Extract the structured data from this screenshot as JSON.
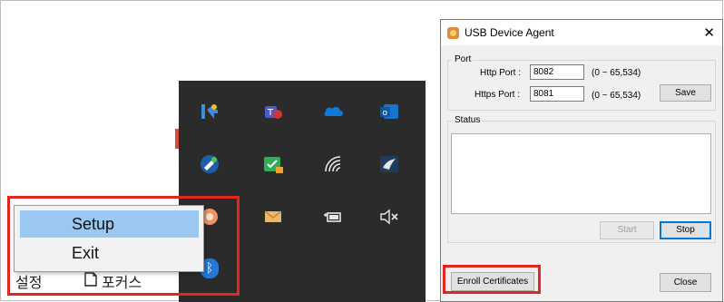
{
  "context_menu": {
    "items": [
      {
        "label": "Setup",
        "highlighted": true
      },
      {
        "label": "Exit",
        "highlighted": false
      }
    ]
  },
  "taskbar": {
    "settings_label": "설정",
    "focus_label": "포커스"
  },
  "tray": {
    "icons": [
      "app-key-icon",
      "teams-icon",
      "onedrive-icon",
      "outlook-icon",
      "satellite-icon",
      "check-lock-icon",
      "wifi-icon",
      "screen-icon",
      "app-orange-icon",
      "mail-icon",
      "battery-icon",
      "volume-mute-icon",
      "bluetooth-icon"
    ]
  },
  "dialog": {
    "title": "USB Device Agent",
    "close_glyph": "✕",
    "port_group_label": "Port",
    "http_label": "Http Port :",
    "http_value": "8082",
    "http_range": "(0 ~ 65,534)",
    "https_label": "Https Port :",
    "https_value": "8081",
    "https_range": "(0 ~ 65,534)",
    "save_label": "Save",
    "status_group_label": "Status",
    "start_label": "Start",
    "stop_label": "Stop",
    "enroll_label": "Enroll Certificates",
    "close_label": "Close"
  },
  "colors": {
    "highlight_frame": "#e3261e",
    "menu_selection": "#9ac8f0",
    "tray_background": "#2b2b2b"
  }
}
